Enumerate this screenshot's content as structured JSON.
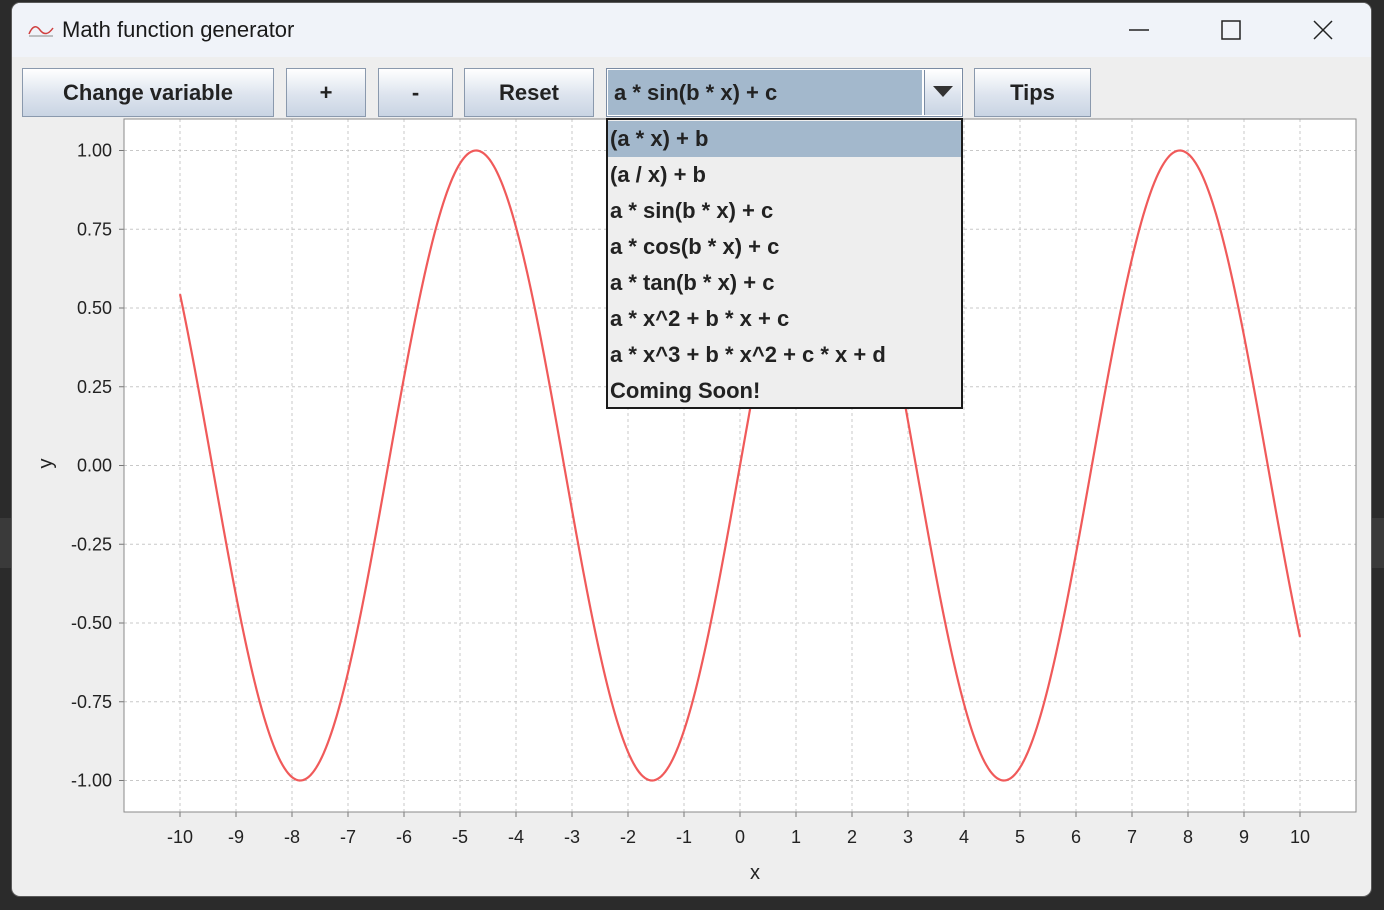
{
  "window": {
    "title": "Math function generator"
  },
  "toolbar": {
    "change_variable": "Change variable",
    "plus": "+",
    "minus": "-",
    "reset": "Reset",
    "tips": "Tips"
  },
  "combo": {
    "selected": "a * sin(b * x) + c"
  },
  "dropdown": {
    "items": [
      "(a * x) + b",
      "(a / x) + b",
      "a * sin(b * x) + c",
      "a * cos(b * x) + c",
      "a * tan(b * x) + c",
      "a * x^2 + b * x + c",
      "a * x^3 + b * x^2 + c * x + d",
      "Coming Soon!"
    ],
    "highlighted_index": 0
  },
  "colors": {
    "curve": "#f05a5a",
    "selection": "#a3b8cc"
  },
  "chart_data": {
    "type": "line",
    "xlabel": "x",
    "ylabel": "y",
    "xlim": [
      -11,
      11
    ],
    "ylim": [
      -1.1,
      1.1
    ],
    "x_ticks": [
      "-10",
      "-9",
      "-8",
      "-7",
      "-6",
      "-5",
      "-4",
      "-3",
      "-2",
      "-1",
      "0",
      "1",
      "2",
      "3",
      "4",
      "5",
      "6",
      "7",
      "8",
      "9",
      "10"
    ],
    "y_ticks": [
      "-1.00",
      "-0.75",
      "-0.50",
      "-0.25",
      "0.00",
      "0.25",
      "0.50",
      "0.75",
      "1.00"
    ],
    "grid": true,
    "function": "a * sin(b * x) + c",
    "params": {
      "a": 1,
      "b": 1,
      "c": 0
    },
    "x_range": [
      -10,
      10
    ],
    "series": [
      {
        "x": [
          -10,
          -9,
          -8,
          -7,
          -6,
          -5,
          -4,
          -3,
          -2,
          -1,
          0,
          1,
          2,
          3,
          4,
          5,
          6,
          7,
          8,
          9,
          10
        ],
        "y": [
          0.544,
          -0.412,
          -0.989,
          -0.657,
          0.279,
          0.959,
          0.757,
          -0.141,
          -0.909,
          -0.841,
          0,
          0.841,
          0.909,
          0.141,
          -0.757,
          -0.959,
          -0.279,
          0.657,
          0.989,
          0.412,
          -0.544
        ]
      }
    ]
  }
}
